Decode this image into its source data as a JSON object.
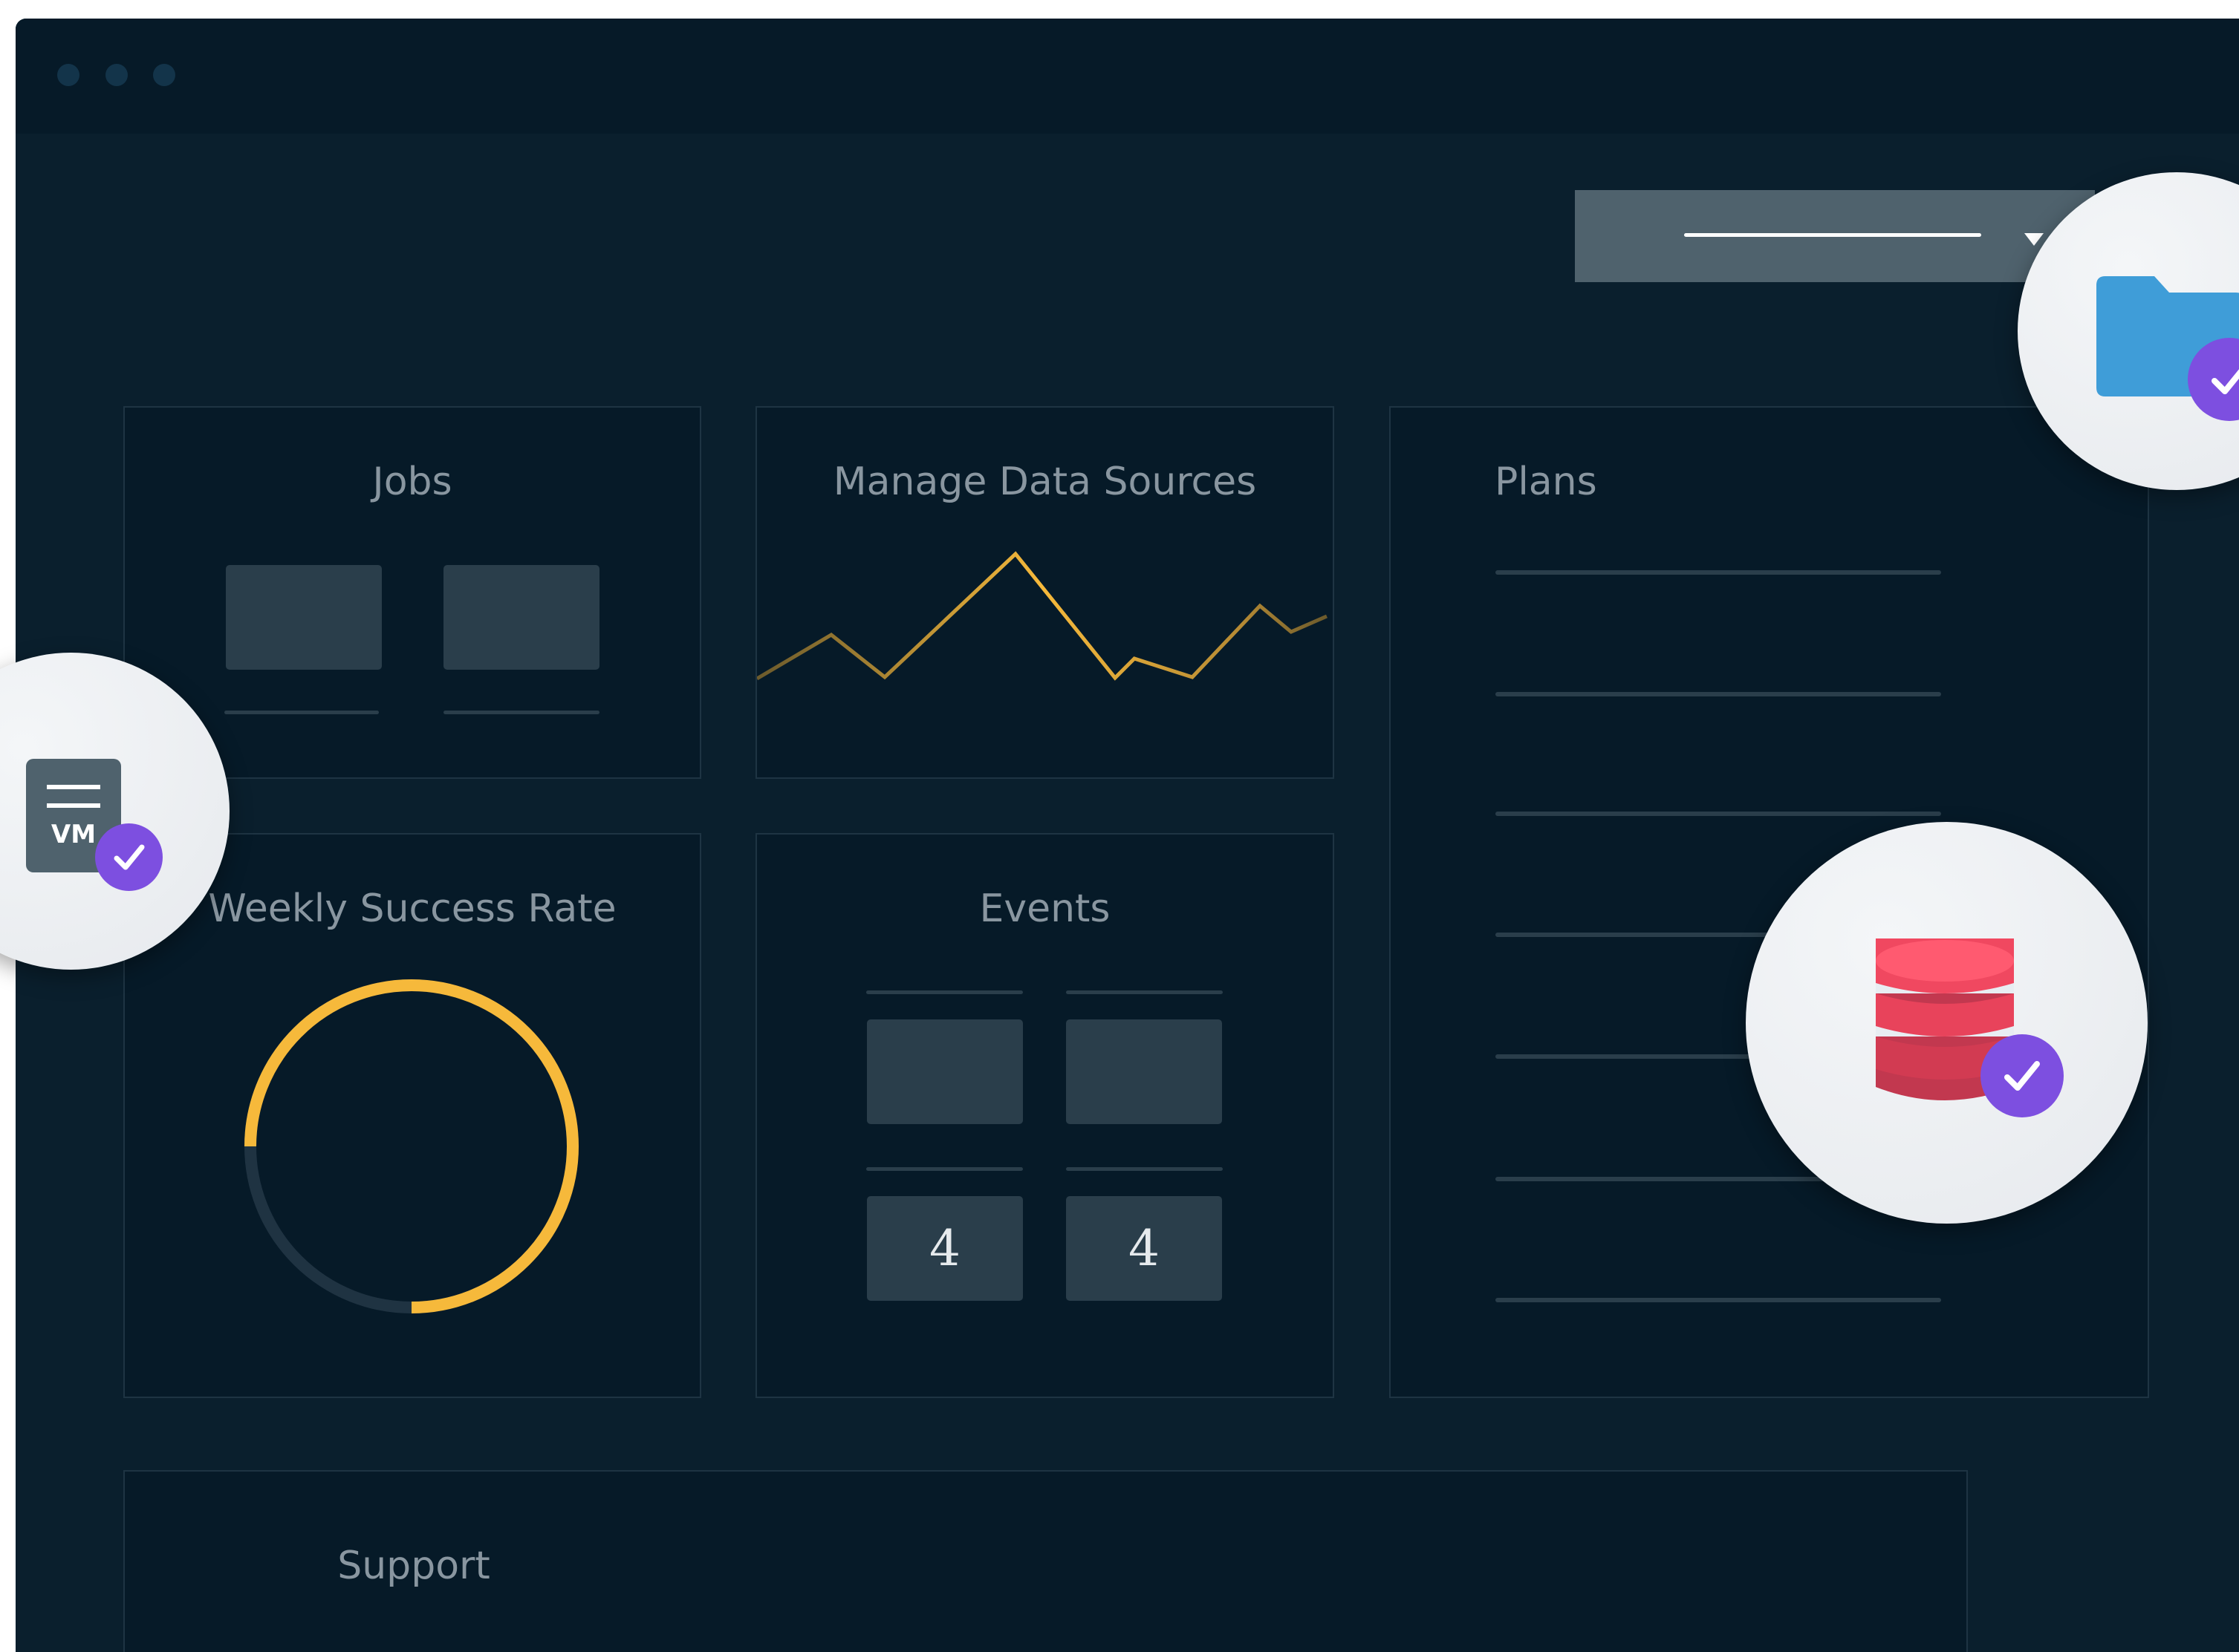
{
  "window": {
    "dropdown": {
      "icon": "chevron-down-icon"
    }
  },
  "cards": {
    "jobs": {
      "title": "Jobs"
    },
    "data_sources": {
      "title": "Manage Data Sources"
    },
    "plans": {
      "title": "Plans"
    },
    "weekly_success": {
      "title": "Weekly Success Rate",
      "progress_percent": 75
    },
    "events": {
      "title": "Events",
      "counts": [
        "4",
        "4"
      ]
    },
    "support": {
      "title": "Support"
    }
  },
  "badges": {
    "vm": {
      "label": "VM",
      "icon": "vm-server-icon",
      "check_icon": "checkmark-icon"
    },
    "folder": {
      "icon": "folder-icon",
      "check_icon": "checkmark-icon"
    },
    "database": {
      "icon": "database-icon",
      "check_icon": "checkmark-icon"
    }
  },
  "colors": {
    "background": "#0a1f2d",
    "card": "#061a28",
    "accent_yellow": "#f6b93b",
    "check_purple": "#7d4fe0",
    "database_red": "#e84a5f",
    "folder_blue": "#3f9dd8"
  }
}
